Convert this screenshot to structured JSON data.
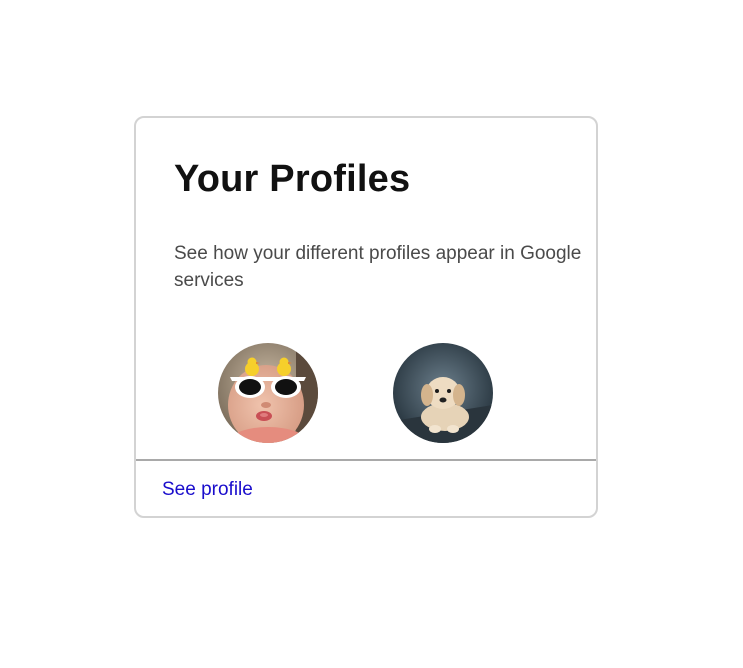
{
  "card": {
    "title": "Your Profiles",
    "description": "See how your different profiles appear in Google services",
    "profiles": [
      {
        "icon": "baby-with-sunglasses-avatar"
      },
      {
        "icon": "golden-retriever-puppy-avatar"
      }
    ],
    "link_label": "See profile"
  },
  "colors": {
    "link": "#1a0dcc",
    "title": "#111111",
    "description": "#4a4a4a",
    "card_border": "#d3d3d3",
    "divider": "#a9a9a9"
  }
}
